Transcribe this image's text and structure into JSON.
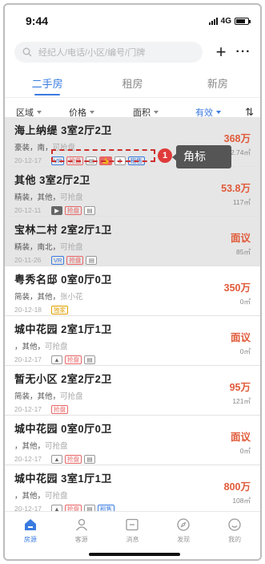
{
  "status": {
    "time": "9:44",
    "network": "4G"
  },
  "search": {
    "placeholder": "经纪人/电话/小区/编号/门牌"
  },
  "header": {
    "add_icon": "plus-icon",
    "more_icon": "more-icon"
  },
  "tabs": [
    {
      "label": "二手房",
      "active": true
    },
    {
      "label": "租房",
      "active": false
    },
    {
      "label": "新房",
      "active": false
    }
  ],
  "filters": [
    {
      "label": "区域",
      "active": false
    },
    {
      "label": "价格",
      "active": false
    },
    {
      "label": "面积",
      "active": false
    },
    {
      "label": "有效",
      "active": true
    }
  ],
  "listings": [
    {
      "title": "海上纳缇  3室2厅2卫",
      "desc": "豪装，南，",
      "note": "可抢盘",
      "date": "20-12-17",
      "price": "368万",
      "area": "112.74㎡",
      "tags": [
        "VR",
        "抢盘",
        "doc",
        "thumb",
        "key",
        "租售"
      ]
    },
    {
      "title": "其他  3室2厅2卫",
      "desc": "精装，其他，",
      "note": "可抢盘",
      "date": "20-12-11",
      "price": "53.8万",
      "area": "117㎡",
      "tags": [
        "video",
        "抢盘",
        "doc"
      ]
    },
    {
      "title": "宝林二村  2室2厅1卫",
      "desc": "精装，南北，",
      "note": "可抢盘",
      "date": "20-11-26",
      "price": "面议",
      "area": "85㎡",
      "tags": [
        "VR",
        "抢盘",
        "doc"
      ]
    },
    {
      "title": "粤秀名邸  0室0厅0卫",
      "desc": "简装，其他，",
      "note": "张小花",
      "date": "20-12-18",
      "price": "350万",
      "area": "0㎡",
      "tags": [
        "独家"
      ]
    },
    {
      "title": "城中花园  2室1厅1卫",
      "desc": "，其他，",
      "note": "可抢盘",
      "date": "20-12-17",
      "price": "面议",
      "area": "0㎡",
      "tags": [
        "image",
        "抢盘",
        "doc"
      ]
    },
    {
      "title": "暂无小区  2室2厅2卫",
      "desc": "简装，其他，",
      "note": "可抢盘",
      "date": "20-12-17",
      "price": "95万",
      "area": "121㎡",
      "tags": [
        "抢盘"
      ]
    },
    {
      "title": "城中花园  0室0厅0卫",
      "desc": "，其他，",
      "note": "可抢盘",
      "date": "20-12-17",
      "price": "面议",
      "area": "0㎡",
      "tags": [
        "image",
        "抢盘",
        "doc"
      ]
    },
    {
      "title": "城中花园  3室1厅1卫",
      "desc": "，其他，",
      "note": "可抢盘",
      "date": "20-12-17",
      "price": "800万",
      "area": "108㎡",
      "tags": [
        "image",
        "抢盘",
        "doc",
        "租售"
      ]
    }
  ],
  "callout": {
    "number": "1",
    "label": "角标"
  },
  "bottom_nav": [
    {
      "label": "房源",
      "icon": "house-icon",
      "active": true
    },
    {
      "label": "客源",
      "icon": "person-icon",
      "active": false
    },
    {
      "label": "消息",
      "icon": "message-icon",
      "active": false
    },
    {
      "label": "发现",
      "icon": "compass-icon",
      "active": false
    },
    {
      "label": "我的",
      "icon": "smile-icon",
      "active": false
    }
  ],
  "colors": {
    "accent": "#3a7be0",
    "price": "#e05a3a",
    "tag_red": "#e86666",
    "callout_red": "#cc2e2e"
  }
}
